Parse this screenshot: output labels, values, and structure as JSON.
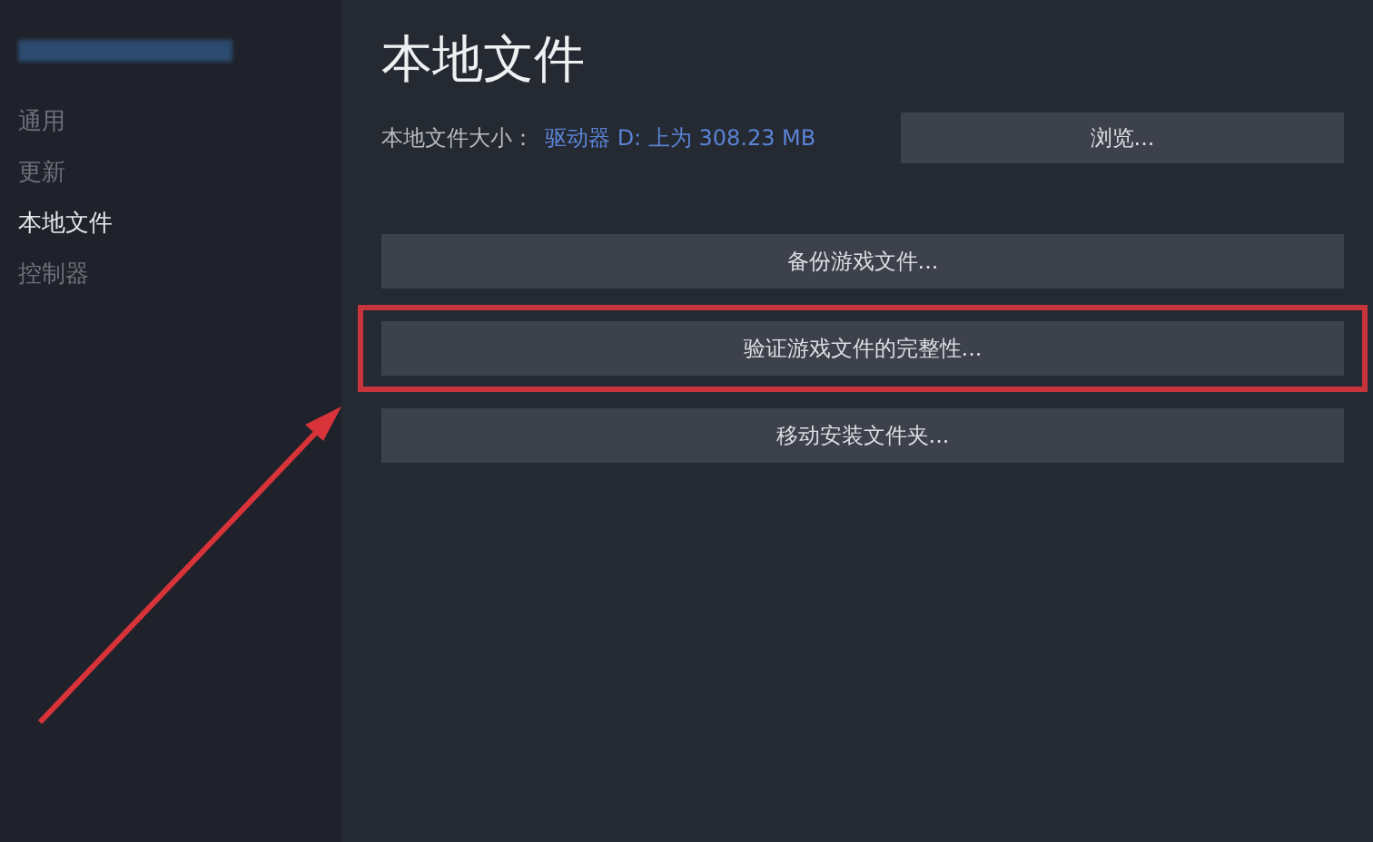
{
  "sidebar": {
    "items": [
      {
        "label": "通用",
        "selected": false
      },
      {
        "label": "更新",
        "selected": false
      },
      {
        "label": "本地文件",
        "selected": true
      },
      {
        "label": "控制器",
        "selected": false
      }
    ]
  },
  "page_title": "本地文件",
  "size_label": "本地文件大小：",
  "size_value": "驱动器 D: 上为 308.23 MB",
  "browse_button": "浏览...",
  "actions": [
    {
      "label": "备份游戏文件...",
      "highlighted": false
    },
    {
      "label": "验证游戏文件的完整性...",
      "highlighted": true
    },
    {
      "label": "移动安装文件夹...",
      "highlighted": false
    }
  ]
}
